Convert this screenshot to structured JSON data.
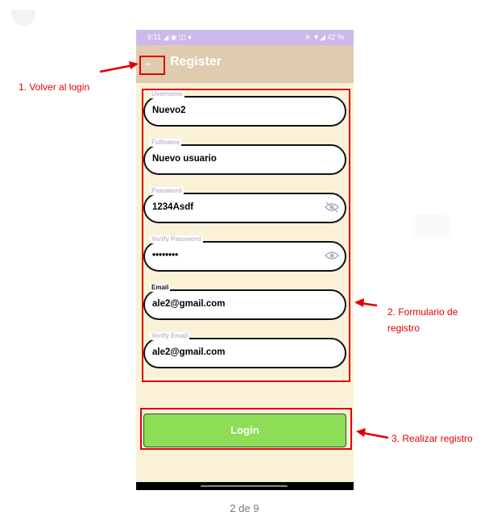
{
  "status_bar": {
    "time": "9:11",
    "left_icons": "◢ ◉ ◫ ♦",
    "right_icons": "✕ ▼◢",
    "battery": "42 %"
  },
  "app_bar": {
    "title": "Register",
    "back_icon": "←"
  },
  "form": {
    "fields": [
      {
        "label": "Username",
        "value": "Nuevo2"
      },
      {
        "label": "Fullname",
        "value": "Nuevo usuario"
      },
      {
        "label": "Password",
        "value": "1234Asdf",
        "icon": "eye-off-icon"
      },
      {
        "label": "Verify Password",
        "value": "••••••••",
        "icon": "eye-icon"
      },
      {
        "label": "Email",
        "value": "ale2@gmail.com"
      },
      {
        "label": "Verify Email",
        "value": "ale2@gmail.com"
      }
    ]
  },
  "login_button": {
    "label": "Login"
  },
  "annotations": {
    "a1": "1. Volver al login",
    "a2_line1": "2. Formulario de",
    "a2_line2": "registro",
    "a3": "3. Realizar registro",
    "color": "#e00000"
  },
  "pager": "2 de 9"
}
